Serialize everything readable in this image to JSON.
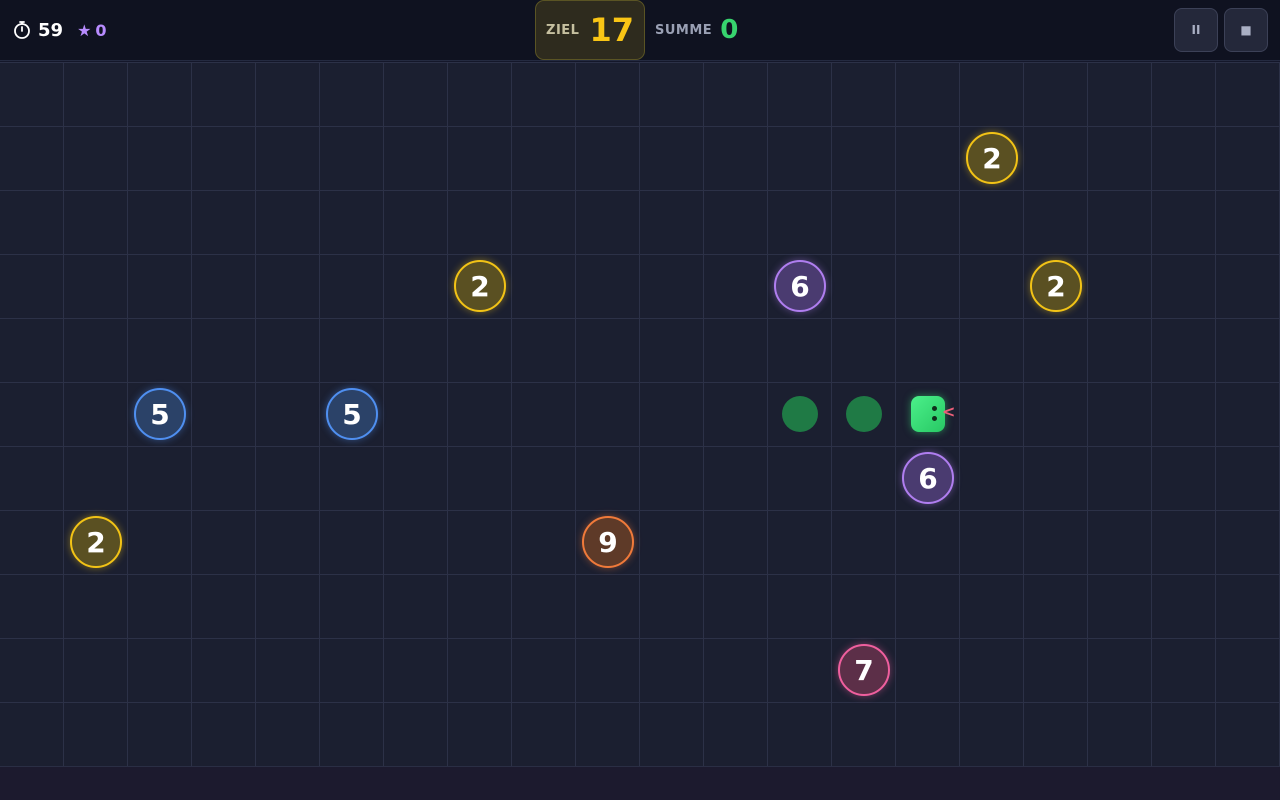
{
  "hud": {
    "timer_icon": "stopwatch-icon",
    "timer": "59",
    "star_icon": "star-icon",
    "stars": "0",
    "target_label": "ZIEL",
    "target_value": "17",
    "sum_label": "SUMME",
    "sum_value": "0",
    "pause_icon": "pause-icon",
    "pause_label": "II",
    "stop_icon": "stop-icon",
    "stop_label": "■",
    "accent_target": "#f9c515",
    "accent_sum": "#37d46e",
    "accent_star": "#b88cff"
  },
  "board": {
    "columns": 20,
    "rows": 11,
    "orbs": [
      {
        "value": "2",
        "color": "yellow",
        "col": 15,
        "row": 1
      },
      {
        "value": "2",
        "color": "yellow",
        "col": 7,
        "row": 3
      },
      {
        "value": "6",
        "color": "purple",
        "col": 12,
        "row": 3
      },
      {
        "value": "2",
        "color": "yellow",
        "col": 16,
        "row": 3
      },
      {
        "value": "5",
        "color": "blue",
        "col": 2,
        "row": 5
      },
      {
        "value": "5",
        "color": "blue",
        "col": 5,
        "row": 5
      },
      {
        "value": "6",
        "color": "purple",
        "col": 14,
        "row": 6
      },
      {
        "value": "2",
        "color": "yellow",
        "col": 1,
        "row": 7
      },
      {
        "value": "9",
        "color": "orange",
        "col": 9,
        "row": 7
      },
      {
        "value": "7",
        "color": "pink",
        "col": 13,
        "row": 9
      }
    ],
    "snake": {
      "head": {
        "col": 14,
        "row": 5
      },
      "body": [
        {
          "col": 13,
          "row": 5
        },
        {
          "col": 12,
          "row": 5
        }
      ],
      "direction": "right",
      "tongue": "<"
    }
  }
}
